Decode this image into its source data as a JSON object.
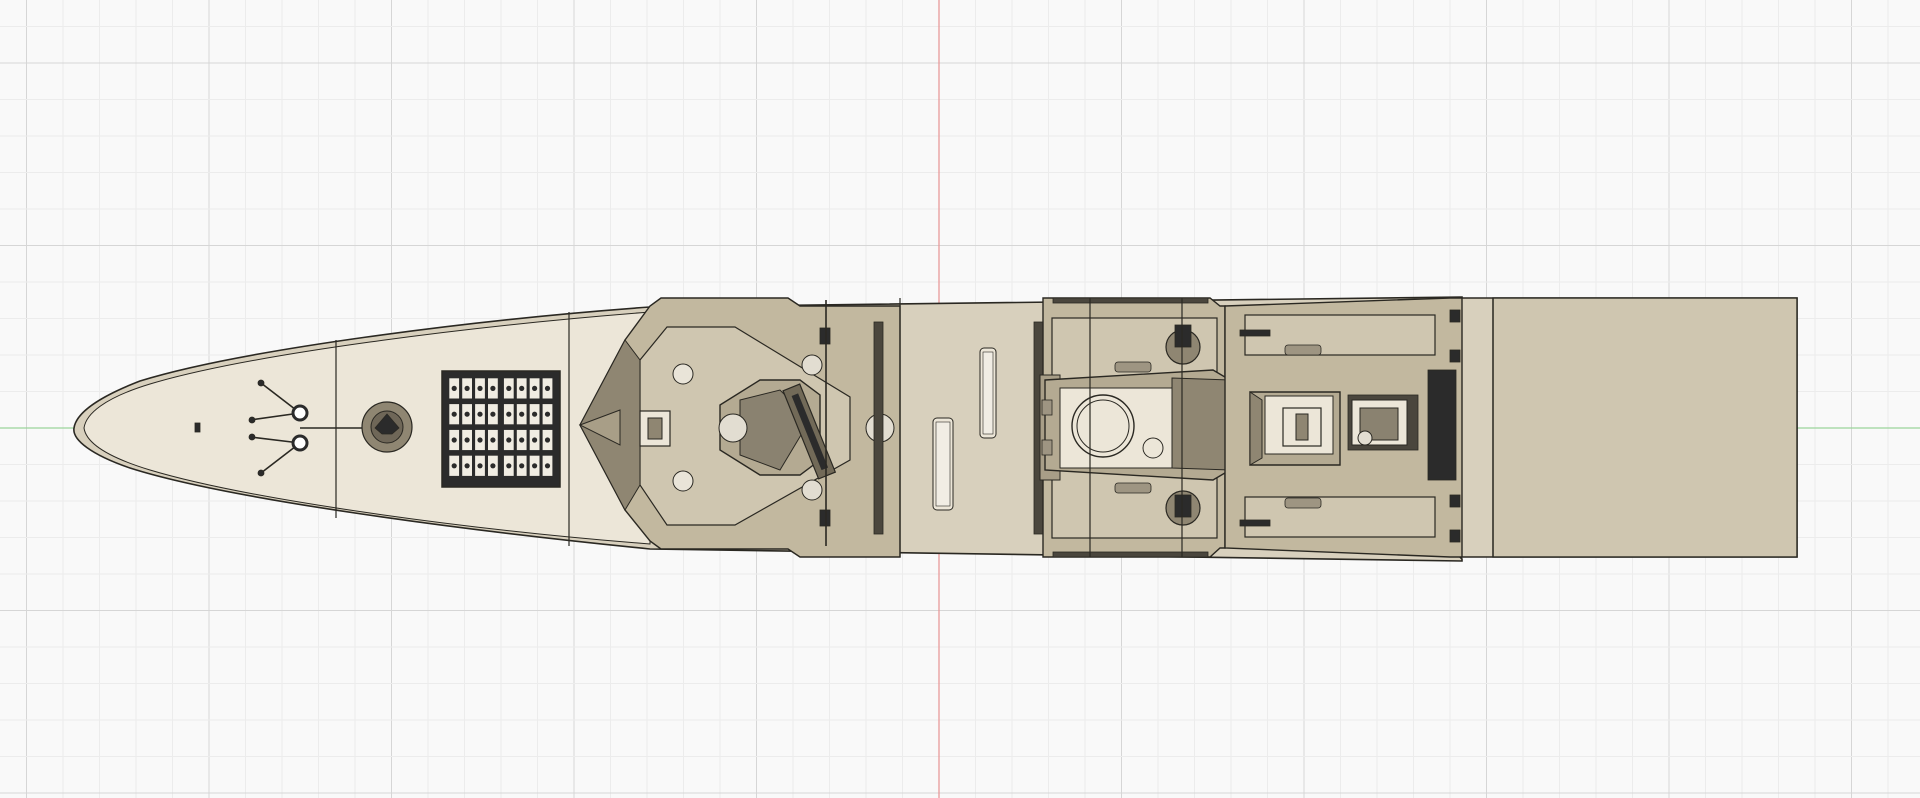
{
  "viewport": {
    "view": "top",
    "background": "#f9f9f9",
    "grid_minor_color": "#ececec",
    "grid_major_color": "#d6d6d6",
    "x_axis_color": "#9bd49b",
    "y_axis_color": "#e89a9a"
  },
  "model": {
    "hull_color": "#d8d0bd",
    "deck_color": "#cfc6b0",
    "superstructure_color": "#c2b89f",
    "shadow_color": "#8f8672",
    "line_color": "#2a2822",
    "dark_color": "#2b2b2b",
    "highlight_color": "#ece6d8",
    "icons": [
      "vls-cells",
      "main-gun-turret",
      "bow-winches",
      "rbs-launcher",
      "radar-mast",
      "ciws-mount",
      "boat-davits"
    ]
  }
}
